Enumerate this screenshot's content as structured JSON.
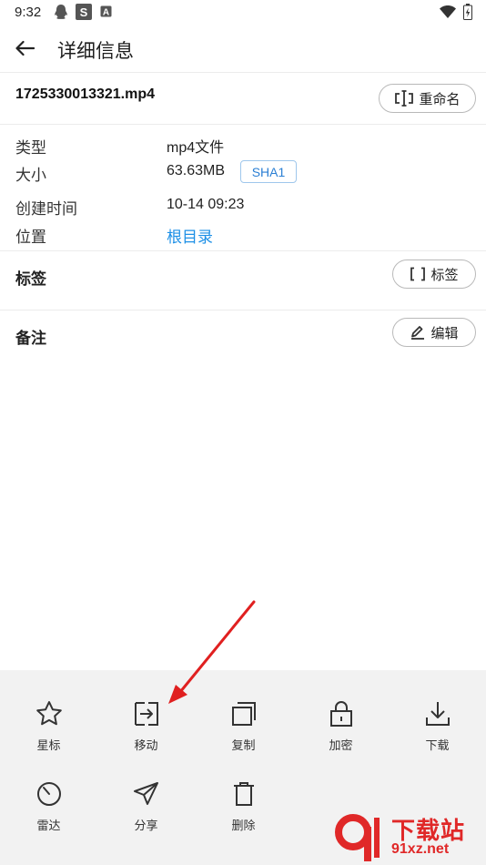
{
  "status_bar": {
    "time": "9:32",
    "icons": [
      "qq-icon",
      "s-app-icon",
      "a-app-icon",
      "wifi-icon",
      "battery-icon"
    ]
  },
  "app_bar": {
    "title": "详细信息",
    "back_icon": "arrow-left-icon"
  },
  "file": {
    "name": "1725330013321.mp4",
    "rename_label": "重命名"
  },
  "info": {
    "type_label": "类型",
    "type_value": "mp4文件",
    "size_label": "大小",
    "size_value": "63.63MB",
    "sha_label": "SHA1",
    "created_label": "创建时间",
    "created_value": "10-14 09:23",
    "location_label": "位置",
    "location_value": "根目录"
  },
  "tags": {
    "title": "标签",
    "button_label": "标签"
  },
  "notes": {
    "title": "备注",
    "button_label": "编辑"
  },
  "actions": [
    {
      "label": "星标",
      "icon": "star-icon"
    },
    {
      "label": "移动",
      "icon": "move-icon"
    },
    {
      "label": "复制",
      "icon": "copy-icon"
    },
    {
      "label": "加密",
      "icon": "lock-icon"
    },
    {
      "label": "下载",
      "icon": "download-icon"
    },
    {
      "label": "雷达",
      "icon": "radar-icon"
    },
    {
      "label": "分享",
      "icon": "share-icon"
    },
    {
      "label": "删除",
      "icon": "trash-icon"
    }
  ],
  "watermark": {
    "top": "下载站",
    "bottom": "91xz.net"
  },
  "colors": {
    "link": "#1e90e6",
    "sheet_bg": "#f2f2f2",
    "annotation_arrow": "#e02020",
    "watermark": "#e02828"
  }
}
